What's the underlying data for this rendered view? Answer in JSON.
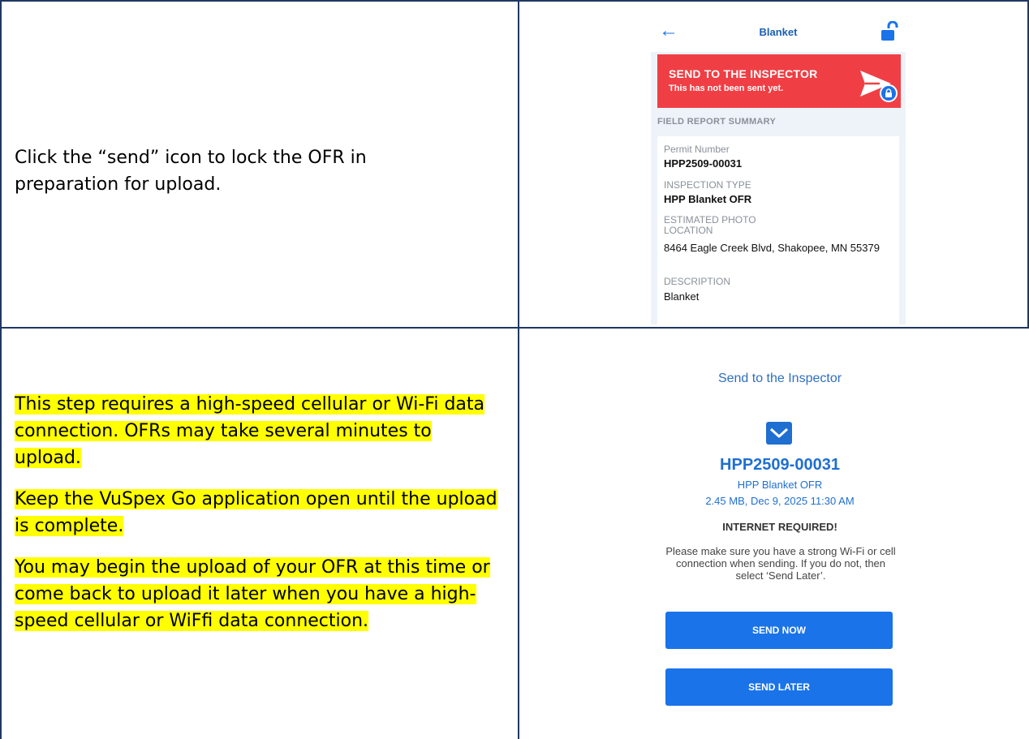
{
  "rows": [
    {
      "instruction": "Click the “send” icon to lock the OFR in preparation for upload."
    },
    {
      "paragraphs": [
        "This step requires a high-speed cellular or Wi-Fi data connection. OFRs may take several minutes to upload.",
        "Keep the VuSpex Go application open until the upload is complete.",
        "You may begin the upload of your OFR at this time or come back to upload it later when you have a high-speed cellular or WiFfi data connection."
      ]
    }
  ],
  "screen1": {
    "header_title": "Blanket",
    "back_icon": "arrow-left-icon",
    "lock_icon": "unlock-icon",
    "banner": {
      "title": "SEND TO THE INSPECTOR",
      "subtitle": "This has not been sent yet.",
      "icon": "send-icon",
      "color": "#ef3f45"
    },
    "summary_heading": "FIELD REPORT SUMMARY",
    "fields": [
      {
        "label": "Permit Number",
        "value": "HPP2509-00031"
      },
      {
        "label": "INSPECTION TYPE",
        "value": "HPP Blanket OFR"
      },
      {
        "label": "ESTIMATED PHOTO LOCATION",
        "value": "8464 Eagle Creek Blvd, Shakopee, MN 55379"
      },
      {
        "label": "DESCRIPTION",
        "value": "Blanket"
      }
    ]
  },
  "screen2": {
    "title": "Send to the Inspector",
    "icon": "mail-icon",
    "permit": "HPP2509-00031",
    "type": "HPP Blanket OFR",
    "meta": "2.45 MB, Dec 9, 2025 11:30 AM",
    "warning": "INTERNET REQUIRED!",
    "message": "Please make sure you have a strong Wi-Fi or cell connection when sending. If you do not, then select ‘Send Later’.",
    "send_now": "SEND NOW",
    "send_later": "SEND LATER",
    "accent": "#1a73e8"
  }
}
